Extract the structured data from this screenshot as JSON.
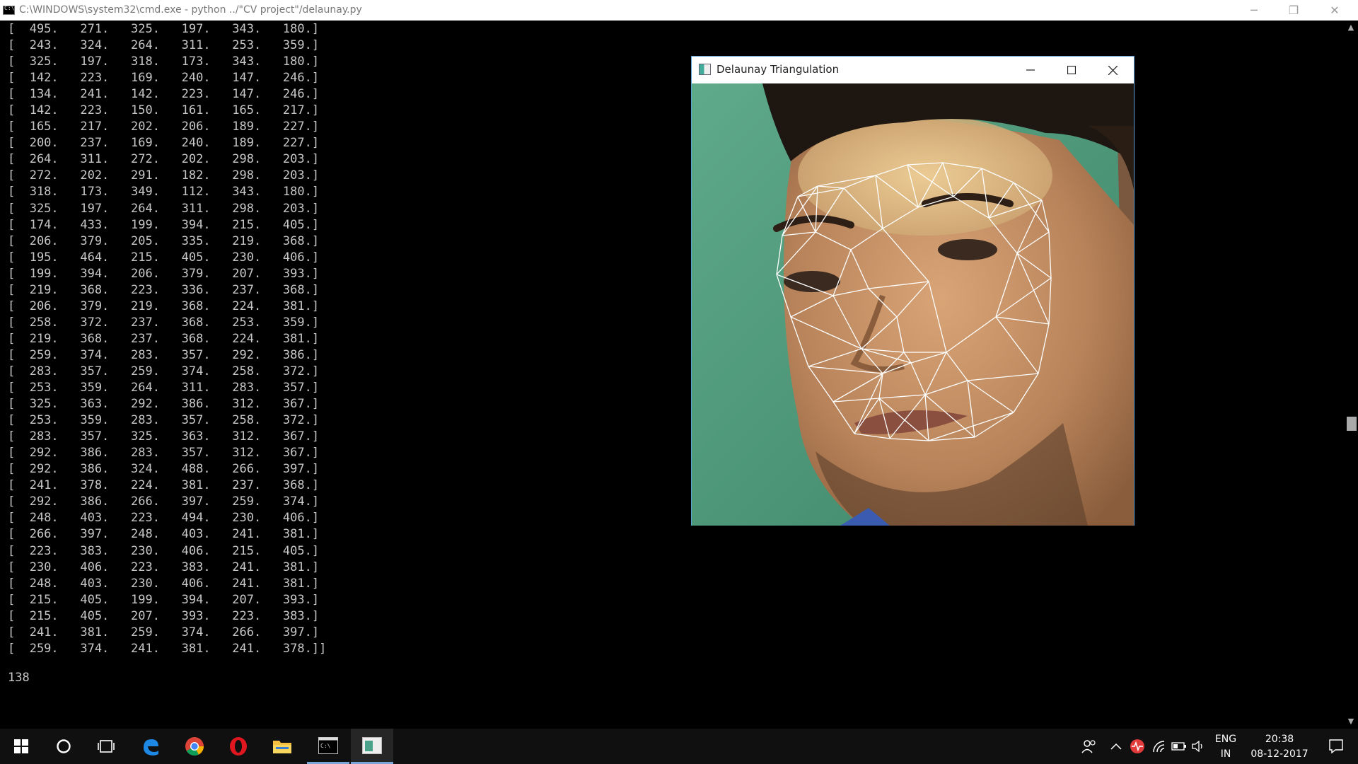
{
  "console": {
    "title": "C:\\WINDOWS\\system32\\cmd.exe - python  ../\"CV project\"/delaunay.py",
    "icon": "cmd-icon",
    "rows": [
      "[  495.   271.   325.   197.   343.   180.]",
      "[  243.   324.   264.   311.   253.   359.]",
      "[  325.   197.   318.   173.   343.   180.]",
      "[  142.   223.   169.   240.   147.   246.]",
      "[  134.   241.   142.   223.   147.   246.]",
      "[  142.   223.   150.   161.   165.   217.]",
      "[  165.   217.   202.   206.   189.   227.]",
      "[  200.   237.   169.   240.   189.   227.]",
      "[  264.   311.   272.   202.   298.   203.]",
      "[  272.   202.   291.   182.   298.   203.]",
      "[  318.   173.   349.   112.   343.   180.]",
      "[  325.   197.   264.   311.   298.   203.]",
      "[  174.   433.   199.   394.   215.   405.]",
      "[  206.   379.   205.   335.   219.   368.]",
      "[  195.   464.   215.   405.   230.   406.]",
      "[  199.   394.   206.   379.   207.   393.]",
      "[  219.   368.   223.   336.   237.   368.]",
      "[  206.   379.   219.   368.   224.   381.]",
      "[  258.   372.   237.   368.   253.   359.]",
      "[  219.   368.   237.   368.   224.   381.]",
      "[  259.   374.   283.   357.   292.   386.]",
      "[  283.   357.   259.   374.   258.   372.]",
      "[  253.   359.   264.   311.   283.   357.]",
      "[  325.   363.   292.   386.   312.   367.]",
      "[  253.   359.   283.   357.   258.   372.]",
      "[  283.   357.   325.   363.   312.   367.]",
      "[  292.   386.   283.   357.   312.   367.]",
      "[  292.   386.   324.   488.   266.   397.]",
      "[  241.   378.   224.   381.   237.   368.]",
      "[  292.   386.   266.   397.   259.   374.]",
      "[  248.   403.   223.   494.   230.   406.]",
      "[  266.   397.   248.   403.   241.   381.]",
      "[  223.   383.   230.   406.   215.   405.]",
      "[  230.   406.   223.   383.   241.   381.]",
      "[  248.   403.   230.   406.   241.   381.]",
      "[  215.   405.   199.   394.   207.   393.]",
      "[  215.   405.   207.   393.   223.   383.]",
      "[  241.   381.   259.   374.   266.   397.]",
      "[  259.   374.   241.   381.   241.   378.]]"
    ],
    "count": "138",
    "buttons": {
      "minimize": "─",
      "restore": "❐",
      "close": "✕"
    }
  },
  "cv_window": {
    "title": "Delaunay Triangulation",
    "icon": "image-window-icon",
    "buttons": {
      "minimize": "minimize-icon",
      "maximize": "maximize-icon",
      "close": "close-icon"
    }
  },
  "taskbar": {
    "items": [
      {
        "name": "start-button",
        "icon": "windows-logo-icon"
      },
      {
        "name": "cortana-button",
        "icon": "cortana-circle-icon"
      },
      {
        "name": "task-view-button",
        "icon": "task-view-icon"
      },
      {
        "name": "edge-button",
        "icon": "edge-icon"
      },
      {
        "name": "chrome-button",
        "icon": "chrome-icon"
      },
      {
        "name": "opera-button",
        "icon": "opera-icon"
      },
      {
        "name": "file-explorer-button",
        "icon": "folder-icon"
      },
      {
        "name": "cmd-taskbar-button",
        "icon": "cmd-icon"
      },
      {
        "name": "opencv-taskbar-button",
        "icon": "image-window-icon"
      }
    ],
    "tray": {
      "lang_top": "ENG",
      "lang_bottom": "IN",
      "time": "20:38",
      "date": "08-12-2017",
      "colors": {
        "accent": "#7aa6d8",
        "antivirus": "#e23b3b"
      }
    }
  }
}
